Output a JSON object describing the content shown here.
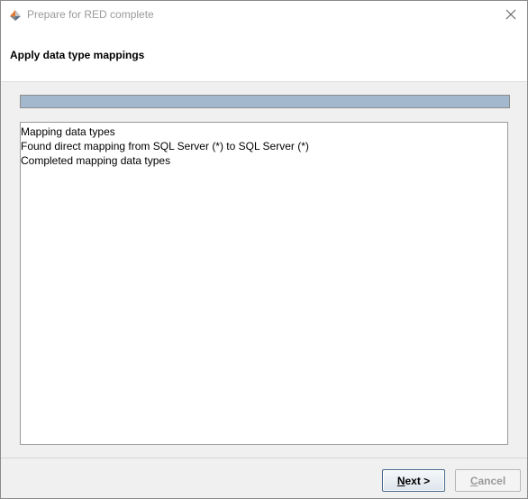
{
  "window": {
    "title": "Prepare for RED complete"
  },
  "header": {
    "title": "Apply data type mappings"
  },
  "progress": {
    "fraction": 1.0,
    "fill_color": "#a3b8cc"
  },
  "log": {
    "lines": [
      "Mapping data types",
      "Found direct mapping from SQL Server (*) to SQL Server (*)",
      "Completed mapping data types"
    ]
  },
  "buttons": {
    "next_label": "Next >",
    "cancel_label": "Cancel"
  },
  "icons": {
    "app": "red-app-icon",
    "close": "close-icon"
  }
}
